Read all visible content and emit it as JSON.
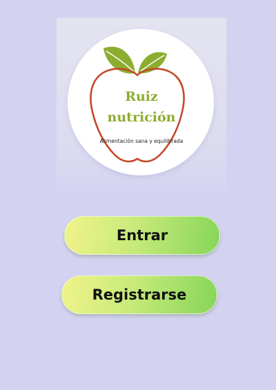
{
  "logo": {
    "brand_line1": "Ruiz",
    "brand_line2": "nutrición",
    "tagline": "Alimentación sana y equilibrada",
    "icon": "apple-outline-icon",
    "colors": {
      "apple_outline": "#c4482a",
      "leaf": "#8dad30",
      "brand_text": "#8dad30"
    }
  },
  "actions": {
    "enter_label": "Entrar",
    "register_label": "Registrarse"
  },
  "colors": {
    "background": "#d3d3f1",
    "button_gradient_start": "#f0f38a",
    "button_gradient_end": "#86d55a"
  }
}
